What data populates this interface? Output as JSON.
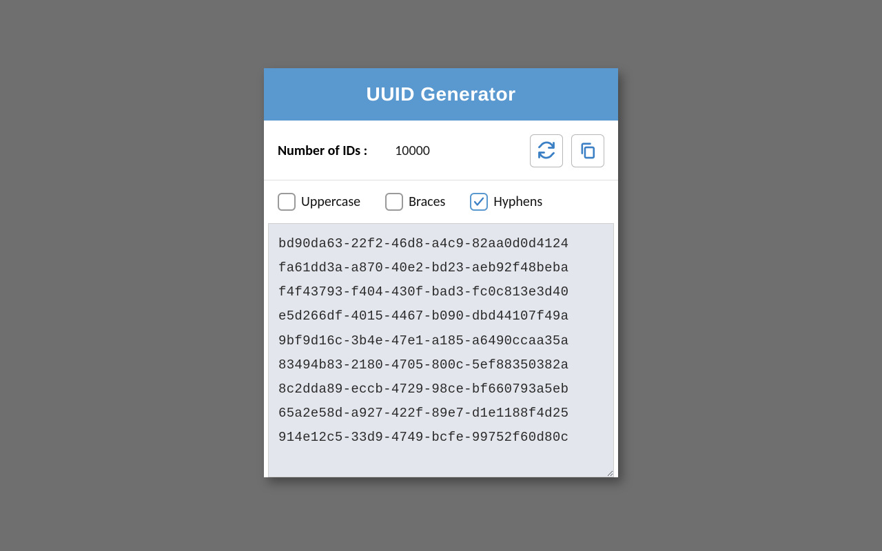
{
  "header": {
    "title": "UUID Generator"
  },
  "controls": {
    "num_label": "Number of IDs :",
    "num_value": "10000"
  },
  "options": {
    "uppercase": {
      "label": "Uppercase",
      "checked": false
    },
    "braces": {
      "label": "Braces",
      "checked": false
    },
    "hyphens": {
      "label": "Hyphens",
      "checked": true
    }
  },
  "output": {
    "lines": [
      "bd90da63-22f2-46d8-a4c9-82aa0d0d4124",
      "fa61dd3a-a870-40e2-bd23-aeb92f48beba",
      "f4f43793-f404-430f-bad3-fc0c813e3d40",
      "e5d266df-4015-4467-b090-dbd44107f49a",
      "9bf9d16c-3b4e-47e1-a185-a6490ccaa35a",
      "83494b83-2180-4705-800c-5ef88350382a",
      "8c2dda89-eccb-4729-98ce-bf660793a5eb",
      "65a2e58d-a927-422f-89e7-d1e1188f4d25",
      "914e12c5-33d9-4749-bcfe-99752f60d80c"
    ]
  },
  "colors": {
    "accent": "#5a98d0"
  }
}
